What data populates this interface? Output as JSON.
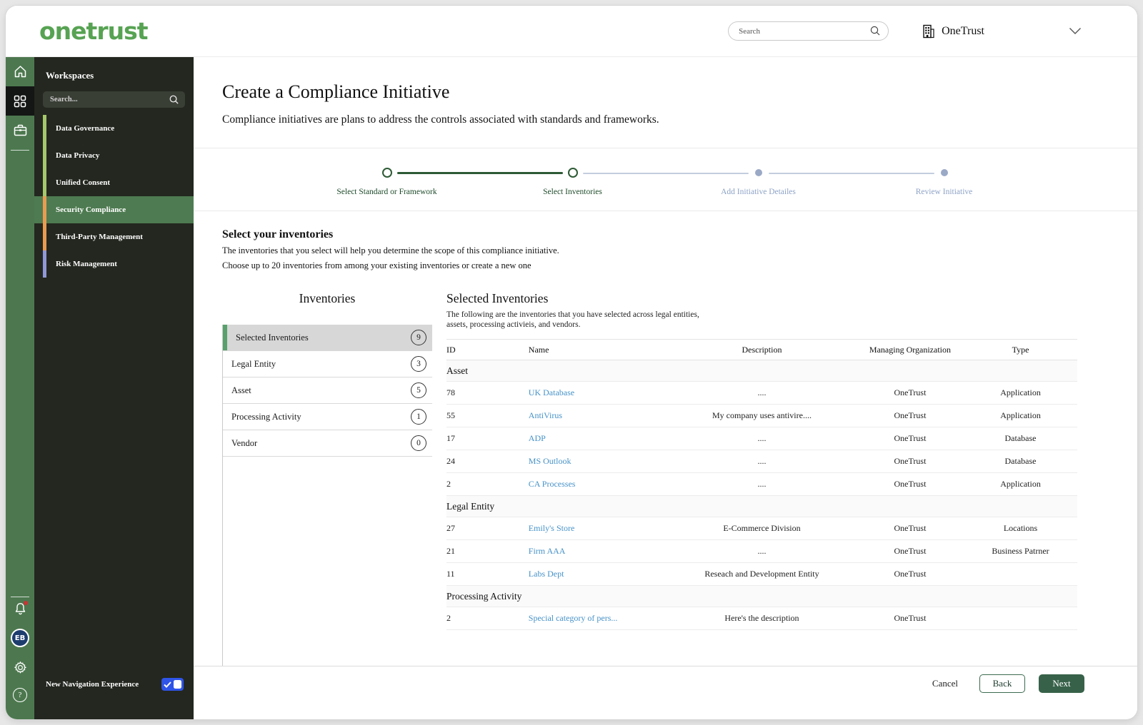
{
  "header": {
    "logo": "onetrust",
    "search_placeholder": "Search",
    "org_name": "OneTrust"
  },
  "sidebar": {
    "title": "Workspaces",
    "search_placeholder": "Search...",
    "items": [
      {
        "label": "Data Governance",
        "bar_color": "#a5c86a",
        "active": false
      },
      {
        "label": "Data Privacy",
        "bar_color": "#a5c86a",
        "active": false
      },
      {
        "label": "Unified Consent",
        "bar_color": "#a5c86a",
        "active": false
      },
      {
        "label": "Security Compliance",
        "bar_color": "#eb9b50",
        "active": true
      },
      {
        "label": "Third-Party Management",
        "bar_color": "#eb9b50",
        "active": false
      },
      {
        "label": "Risk Management",
        "bar_color": "#9198d8",
        "active": false
      }
    ],
    "avatar_initials": "EB",
    "toggle_label": "New Navigation Experience",
    "toggle_on": true
  },
  "page": {
    "title": "Create a Compliance Initiative",
    "subtitle": "Compliance initiatives are plans to address the controls associated with standards and frameworks."
  },
  "stepper": {
    "steps": [
      {
        "label": "Select Standard or Framework",
        "state": "complete"
      },
      {
        "label": "Select Inventories",
        "state": "current"
      },
      {
        "label": "Add Initiative Detailes",
        "state": "upcoming"
      },
      {
        "label": "Review Initiative",
        "state": "upcoming"
      }
    ]
  },
  "section": {
    "heading": "Select your inventories",
    "line1": "The inventories that you select will help you determine the scope of this compliance initiative.",
    "line2": "Choose up to 20 inventories from among your existing inventories or create a new one"
  },
  "inventories_list": {
    "title": "Inventories",
    "items": [
      {
        "label": "Selected Inventories",
        "count": "9",
        "active": true
      },
      {
        "label": "Legal Entity",
        "count": "3",
        "active": false
      },
      {
        "label": "Asset",
        "count": "5",
        "active": false
      },
      {
        "label": "Processing Activity",
        "count": "1",
        "active": false
      },
      {
        "label": "Vendor",
        "count": "0",
        "active": false
      }
    ]
  },
  "selected": {
    "title": "Selected Inventories",
    "desc_line1": "The following are the inventories that you have selected across legal entities,",
    "desc_line2": "assets, processing activieis, and vendors.",
    "columns": [
      "ID",
      "Name",
      "Description",
      "Managing Organization",
      "Type"
    ],
    "groups": [
      {
        "name": "Asset",
        "rows": [
          {
            "id": "78",
            "name": "UK Database",
            "description": "....",
            "org": "OneTrust",
            "type": "Application"
          },
          {
            "id": "55",
            "name": "AntiVirus",
            "description": "My company uses antivire....",
            "org": "OneTrust",
            "type": "Application"
          },
          {
            "id": "17",
            "name": "ADP",
            "description": "....",
            "org": "OneTrust",
            "type": "Database"
          },
          {
            "id": "24",
            "name": "MS Outlook",
            "description": "....",
            "org": "OneTrust",
            "type": "Database"
          },
          {
            "id": "2",
            "name": "CA Processes",
            "description": "....",
            "org": "OneTrust",
            "type": "Application"
          }
        ]
      },
      {
        "name": "Legal Entity",
        "rows": [
          {
            "id": "27",
            "name": "Emily's Store",
            "description": "E-Commerce Division",
            "org": "OneTrust",
            "type": "Locations"
          },
          {
            "id": "21",
            "name": "Firm AAA",
            "description": "....",
            "org": "OneTrust",
            "type": "Business Patrner"
          },
          {
            "id": "11",
            "name": "Labs Dept",
            "description": "Reseach and Development Entity",
            "org": "OneTrust",
            "type": ""
          }
        ]
      },
      {
        "name": "Processing Activity",
        "rows": [
          {
            "id": "2",
            "name": "Special category of pers...",
            "description": "Here's the description",
            "org": "OneTrust",
            "type": ""
          }
        ]
      }
    ]
  },
  "footer": {
    "cancel_label": "Cancel",
    "back_label": "Back",
    "next_label": "Next"
  },
  "icons": [
    "search-icon",
    "building-icon",
    "chevron-down-icon",
    "home-icon",
    "apps-grid-icon",
    "briefcase-icon",
    "bell-icon",
    "gear-icon",
    "help-icon",
    "checkmark-icon"
  ],
  "colors": {
    "brand_green": "#57a353",
    "rail_green": "#4d784f",
    "panel_dark": "#23271f",
    "active_workspace_green": "#4e7b51",
    "stepper_green": "#2d5a35",
    "stepper_inactive": "#9aa9c6",
    "link_blue": "#4692c8",
    "next_button_green": "#376249",
    "toggle_blue": "#2f54e8",
    "avatar_navy": "#1d3c6e",
    "notification_red": "#c73434"
  }
}
